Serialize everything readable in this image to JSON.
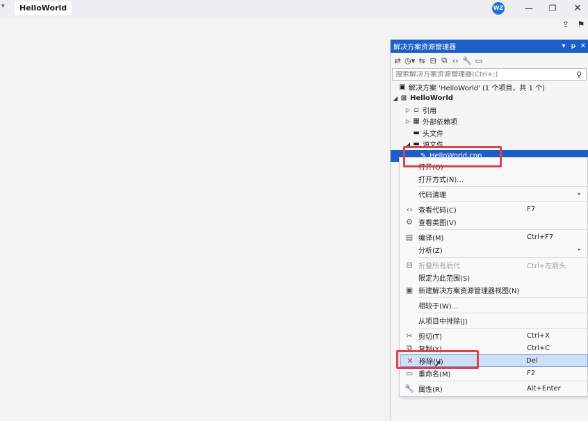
{
  "window": {
    "menu_arrow": "▾",
    "title": "HelloWorld",
    "avatar": "WZ",
    "minimize": "—",
    "maximize": "❐",
    "close": "✕"
  },
  "solution_explorer": {
    "title": "解决方案资源管理器",
    "header_buttons": [
      "▾",
      "ᵽ",
      "✕"
    ],
    "search_placeholder": "搜索解决方案资源管理器(Ctrl+;)",
    "tree": [
      {
        "label": "解决方案 'HelloWorld' (1 个项目，共 1 个)",
        "expander": "",
        "icon": "▣"
      },
      {
        "label": "HelloWorld",
        "expander": "◢",
        "icon": "⊞"
      },
      {
        "label": "引用",
        "expander": "▷",
        "icon": "▫"
      },
      {
        "label": "外部依赖项",
        "expander": "▷",
        "icon": "▦"
      },
      {
        "label": "头文件",
        "expander": "",
        "icon": "▬"
      },
      {
        "label": "源文件",
        "expander": "◢",
        "icon": "▬"
      },
      {
        "label": "HelloWorld.cpp",
        "expander": "",
        "icon": "✎"
      }
    ]
  },
  "context_menu": {
    "items": [
      {
        "icon": "",
        "label": "打开(O)",
        "shortcut": "",
        "sub": ""
      },
      {
        "icon": "",
        "label": "打开方式(N)...",
        "shortcut": "",
        "sub": ""
      },
      {
        "icon": "",
        "label": "代码清理",
        "shortcut": "",
        "sub": "▸"
      },
      {
        "icon": "‹›",
        "label": "查看代码(C)",
        "shortcut": "F7",
        "sub": ""
      },
      {
        "icon": "⚙",
        "label": "查看类图(V)",
        "shortcut": "",
        "sub": ""
      },
      {
        "icon": "▤",
        "label": "编译(M)",
        "shortcut": "Ctrl+F7",
        "sub": ""
      },
      {
        "icon": "",
        "label": "分析(Z)",
        "shortcut": "",
        "sub": "▸"
      },
      {
        "icon": "⊟",
        "label": "折叠所有后代",
        "shortcut": "Ctrl+左箭头",
        "sub": ""
      },
      {
        "icon": "",
        "label": "限定为此范围(S)",
        "shortcut": "",
        "sub": ""
      },
      {
        "icon": "▣",
        "label": "新建解决方案资源管理器视图(N)",
        "shortcut": "",
        "sub": ""
      },
      {
        "icon": "",
        "label": "相较于(W)...",
        "shortcut": "",
        "sub": ""
      },
      {
        "icon": "",
        "label": "从项目中排除(J)",
        "shortcut": "",
        "sub": ""
      },
      {
        "icon": "✂",
        "label": "剪切(T)",
        "shortcut": "Ctrl+X",
        "sub": ""
      },
      {
        "icon": "⧉",
        "label": "复制(Y)",
        "shortcut": "Ctrl+C",
        "sub": ""
      },
      {
        "icon": "✕",
        "label": "移除(V)",
        "shortcut": "Del",
        "sub": ""
      },
      {
        "icon": "▭",
        "label": "重命名(M)",
        "shortcut": "F2",
        "sub": ""
      },
      {
        "icon": "🔧",
        "label": "属性(R)",
        "shortcut": "Alt+Enter",
        "sub": ""
      }
    ]
  },
  "colors": {
    "accent": "#1c5fc6",
    "highlight_bg": "#cde0f5",
    "annotation": "#e0404a"
  }
}
